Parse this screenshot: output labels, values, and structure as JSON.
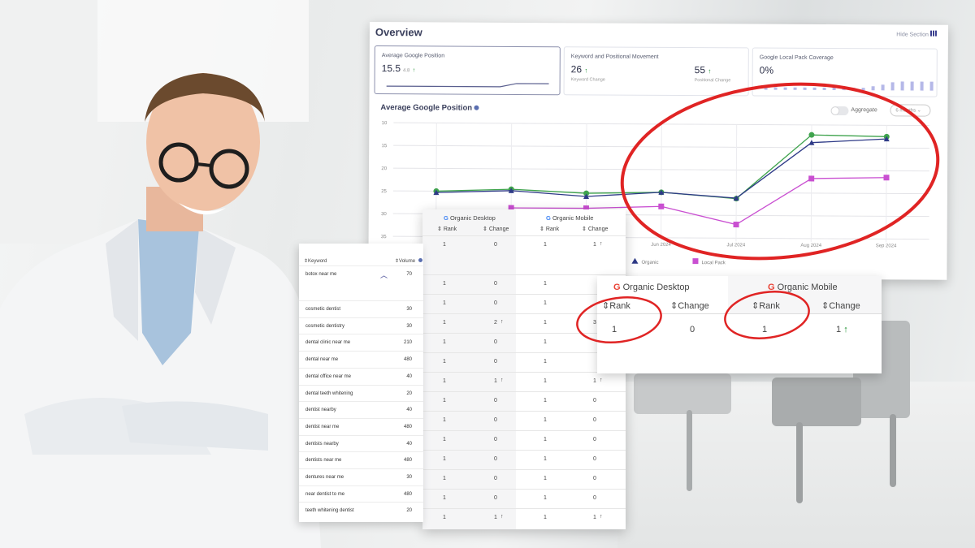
{
  "overview": {
    "title": "Overview",
    "hide_label": "Hide Section",
    "kpis": [
      {
        "label": "Average Google Position",
        "value": "15.5",
        "sub": "4.8"
      },
      {
        "label": "Keyword and Positional Movement",
        "value1": "26",
        "cap1": "Keyword Change",
        "value2": "55",
        "cap2": "Positional Change"
      },
      {
        "label": "Google Local Pack Coverage",
        "value": "0%"
      }
    ],
    "chart_title": "Average Google Position",
    "aggregate_label": "Aggregate",
    "period_label": "6 months"
  },
  "chart_data": {
    "type": "line",
    "title": "Average Google Position",
    "x": [
      "",
      "",
      "",
      "Jun 2024",
      "Jul 2024",
      "Aug 2024",
      "Sep 2024"
    ],
    "y_ticks": [
      "10",
      "15",
      "20",
      "25",
      "30",
      "35"
    ],
    "ylim": [
      10,
      35
    ],
    "y_inverted": true,
    "grid": true,
    "series": [
      {
        "color": "#3fa34d",
        "values": [
          25,
          24.5,
          25.3,
          25,
          26.3,
          12.2,
          12.5
        ]
      },
      {
        "color": "#2e3a87",
        "values": [
          25.3,
          24.8,
          26,
          25,
          26.2,
          13.9,
          13
        ]
      },
      {
        "color": "#c94fd1",
        "values": [
          null,
          28.6,
          28.6,
          28.1,
          32,
          21.8,
          21.5
        ]
      }
    ],
    "legend": [
      "Organic",
      "Local Pack"
    ]
  },
  "table": {
    "desktop_header": "Organic Desktop",
    "mobile_header": "Organic Mobile",
    "rank_label": "Rank",
    "change_label": "Change",
    "rows": [
      {
        "d_rank": "1",
        "d_change": "0",
        "m_rank": "1",
        "m_change": "1"
      },
      {
        "d_rank": "1",
        "d_change": "0",
        "m_rank": "1",
        "m_change": ""
      },
      {
        "d_rank": "1",
        "d_change": "0",
        "m_rank": "1",
        "m_change": ""
      },
      {
        "d_rank": "1",
        "d_change": "2",
        "m_rank": "1",
        "m_change": "3"
      },
      {
        "d_rank": "1",
        "d_change": "0",
        "m_rank": "1",
        "m_change": ""
      },
      {
        "d_rank": "1",
        "d_change": "0",
        "m_rank": "1",
        "m_change": ""
      },
      {
        "d_rank": "1",
        "d_change": "1",
        "m_rank": "1",
        "m_change": "1"
      },
      {
        "d_rank": "1",
        "d_change": "0",
        "m_rank": "1",
        "m_change": "0"
      },
      {
        "d_rank": "1",
        "d_change": "0",
        "m_rank": "1",
        "m_change": "0"
      },
      {
        "d_rank": "1",
        "d_change": "0",
        "m_rank": "1",
        "m_change": "0"
      },
      {
        "d_rank": "1",
        "d_change": "0",
        "m_rank": "1",
        "m_change": "0"
      },
      {
        "d_rank": "1",
        "d_change": "0",
        "m_rank": "1",
        "m_change": "0"
      },
      {
        "d_rank": "1",
        "d_change": "0",
        "m_rank": "1",
        "m_change": "0"
      },
      {
        "d_rank": "1",
        "d_change": "1",
        "m_rank": "1",
        "m_change": "1"
      }
    ],
    "up_rows": [
      0,
      3,
      6,
      13
    ]
  },
  "keywords": {
    "keyword_header": "Keyword",
    "volume_header": "Volume",
    "rows": [
      {
        "keyword": "botox near me",
        "volume": "70"
      },
      {
        "keyword": "cosmetic dentist",
        "volume": "30"
      },
      {
        "keyword": "cosmetic dentistry",
        "volume": "30"
      },
      {
        "keyword": "dental clinic near me",
        "volume": "210"
      },
      {
        "keyword": "dental near me",
        "volume": "480"
      },
      {
        "keyword": "dental office near me",
        "volume": "40"
      },
      {
        "keyword": "dental teeth whitening",
        "volume": "20"
      },
      {
        "keyword": "dentist nearby",
        "volume": "40"
      },
      {
        "keyword": "dentist near me",
        "volume": "480"
      },
      {
        "keyword": "dentists nearby",
        "volume": "40"
      },
      {
        "keyword": "dentists near me",
        "volume": "480"
      },
      {
        "keyword": "dentures near me",
        "volume": "30"
      },
      {
        "keyword": "near dentist to me",
        "volume": "480"
      },
      {
        "keyword": "teeth whitening dentist",
        "volume": "20"
      }
    ]
  },
  "zoom": {
    "desktop_header": "Organic Desktop",
    "mobile_header": "Organic Mobile",
    "rank_label": "Rank",
    "change_label": "Change",
    "d_rank": "1",
    "d_change": "0",
    "m_rank": "1",
    "m_change": "1"
  },
  "colors": {
    "accent_red": "#e02424",
    "up_green": "#1b8f2d",
    "navy": "#3a3f5c"
  },
  "icons": [
    "google-icon",
    "sort-icon",
    "up-arrow-icon",
    "info-icon",
    "chevron-up-icon",
    "bar-chart-icon"
  ]
}
